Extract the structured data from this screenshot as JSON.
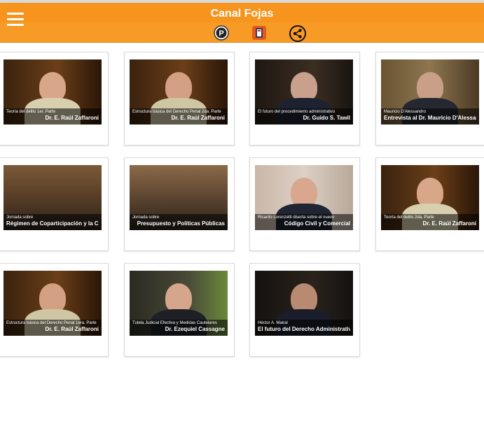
{
  "header": {
    "title": "Canal Fojas",
    "icons": [
      "menu-icon",
      "parking-icon",
      "book-icon",
      "share-icon"
    ]
  },
  "colors": {
    "header": "#f7941d",
    "title": "#ffffff",
    "card_border": "#dadada"
  },
  "videos": [
    {
      "line1": "Teoría del delito 1er. Parte",
      "line2": "Dr. E. Raúl Zaffaroni"
    },
    {
      "line1": "Estructura básica del Derecho Penal 2da. Parte",
      "line2": "Dr. E. Raúl Zaffaroni"
    },
    {
      "line1": "El futuro del procedimiento administrativo",
      "line2": "Dr. Guido S. Tawil"
    },
    {
      "line1": "Mauricio D'Alessandro",
      "line2": "Entrevista al Dr. Mauricio D'Alessandro"
    },
    {
      "line1": "Jornada sobre",
      "line2": "Régimen de Coparticipación y la CABA"
    },
    {
      "line1": "Jornada sobre",
      "line2": "Presupuesto y Políticas Públicas"
    },
    {
      "line1": "Ricardo Lorenzetti diserta sobre el nuevo",
      "line2": "Código Civil y Comercial"
    },
    {
      "line1": "Teoría del delito 2da. Parte",
      "line2": "Dr. E. Raúl Zaffaroni"
    },
    {
      "line1": "Estructura básica del Derecho Penal 1era. Parte",
      "line2": "Dr. E. Raúl Zaffaroni"
    },
    {
      "line1": "Tutela Judicial Efectiva y Medidas Cautelares",
      "line2": "Dr. Ezequiel Cassagne"
    },
    {
      "line1": "Héctor A. Mairal",
      "line2": "El futuro del Derecho Administrativo"
    }
  ]
}
